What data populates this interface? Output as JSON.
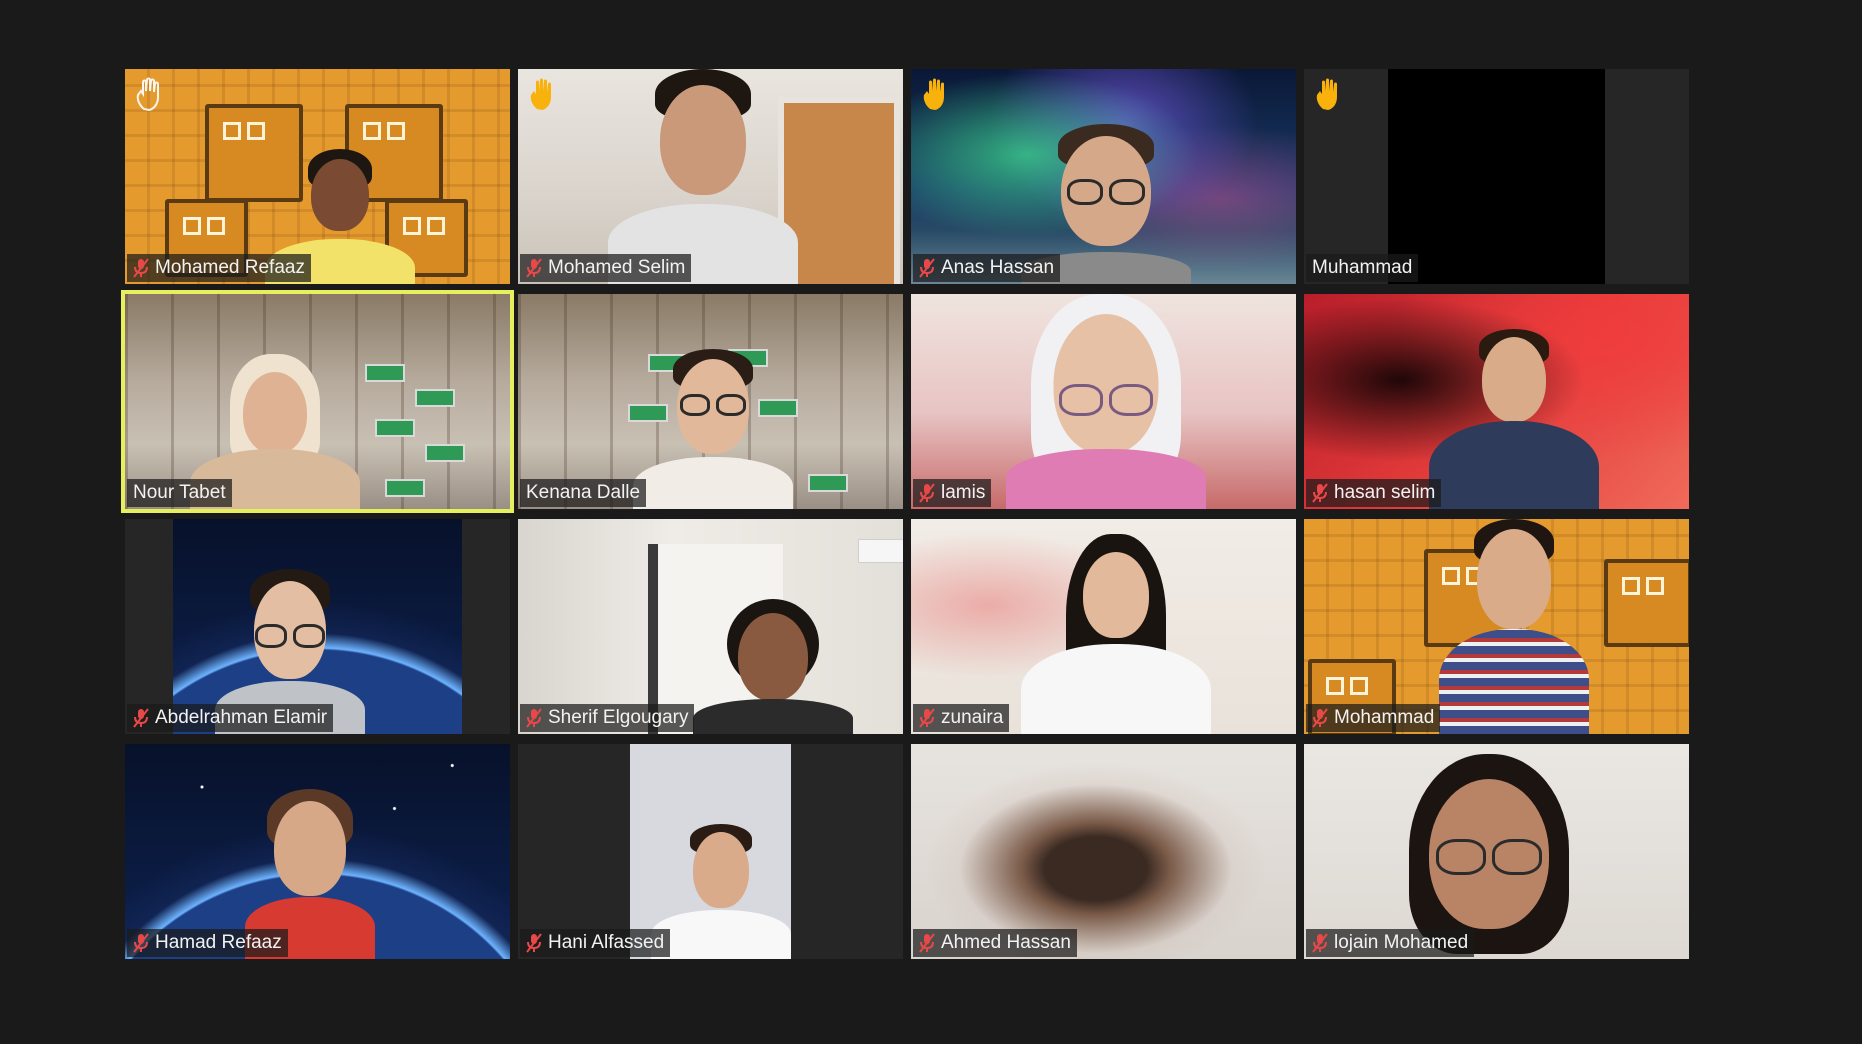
{
  "meeting": {
    "participants": [
      {
        "name": "Mohamed Refaaz",
        "muted": true,
        "hand_raised": true,
        "hand_style": "outline",
        "active_speaker": false,
        "background": "orange-blocks"
      },
      {
        "name": "Mohamed Selim",
        "muted": true,
        "hand_raised": true,
        "hand_style": "filled",
        "active_speaker": false,
        "background": "room-door"
      },
      {
        "name": "Anas Hassan",
        "muted": true,
        "hand_raised": true,
        "hand_style": "filled",
        "active_speaker": false,
        "background": "aurora"
      },
      {
        "name": "Muhammad",
        "muted": false,
        "hand_raised": true,
        "hand_style": "filled",
        "active_speaker": false,
        "background": "video-off-black"
      },
      {
        "name": "Nour Tabet",
        "muted": false,
        "hand_raised": false,
        "active_speaker": true,
        "background": "chess-hall"
      },
      {
        "name": "Kenana Dalle",
        "muted": false,
        "hand_raised": false,
        "active_speaker": false,
        "background": "chess-hall"
      },
      {
        "name": "lamis",
        "muted": true,
        "hand_raised": false,
        "active_speaker": false,
        "background": "room-pink"
      },
      {
        "name": "hasan selim",
        "muted": true,
        "hand_raised": false,
        "active_speaker": false,
        "background": "spider-hero"
      },
      {
        "name": "Abdelrahman Elamir",
        "muted": true,
        "hand_raised": false,
        "active_speaker": false,
        "background": "earth-space"
      },
      {
        "name": "Sherif Elgougary",
        "muted": true,
        "hand_raised": false,
        "active_speaker": false,
        "background": "room-wall"
      },
      {
        "name": "zunaira",
        "muted": true,
        "hand_raised": false,
        "active_speaker": false,
        "background": "blurred-room"
      },
      {
        "name": "Mohammad",
        "muted": true,
        "hand_raised": false,
        "active_speaker": false,
        "background": "orange-blocks"
      },
      {
        "name": "Hamad Refaaz",
        "muted": true,
        "hand_raised": false,
        "active_speaker": false,
        "background": "earth-space"
      },
      {
        "name": "Hani Alfassed",
        "muted": true,
        "hand_raised": false,
        "active_speaker": false,
        "background": "narrow-room"
      },
      {
        "name": "Ahmed Hassan",
        "muted": true,
        "hand_raised": false,
        "active_speaker": false,
        "background": "blurred-face"
      },
      {
        "name": "lojain Mohamed",
        "muted": true,
        "hand_raised": false,
        "active_speaker": false,
        "background": "plain-wall"
      }
    ]
  },
  "icons": {
    "muted_mic": "mic-off-icon",
    "raised_hand": "raised-hand-icon"
  },
  "colors": {
    "window_background": "#1a1a1a",
    "active_speaker_border": "#e6ef5e",
    "mute_icon": "#e84848",
    "hand_filled": "#f3b11a",
    "label_text": "#f2f2f2"
  }
}
